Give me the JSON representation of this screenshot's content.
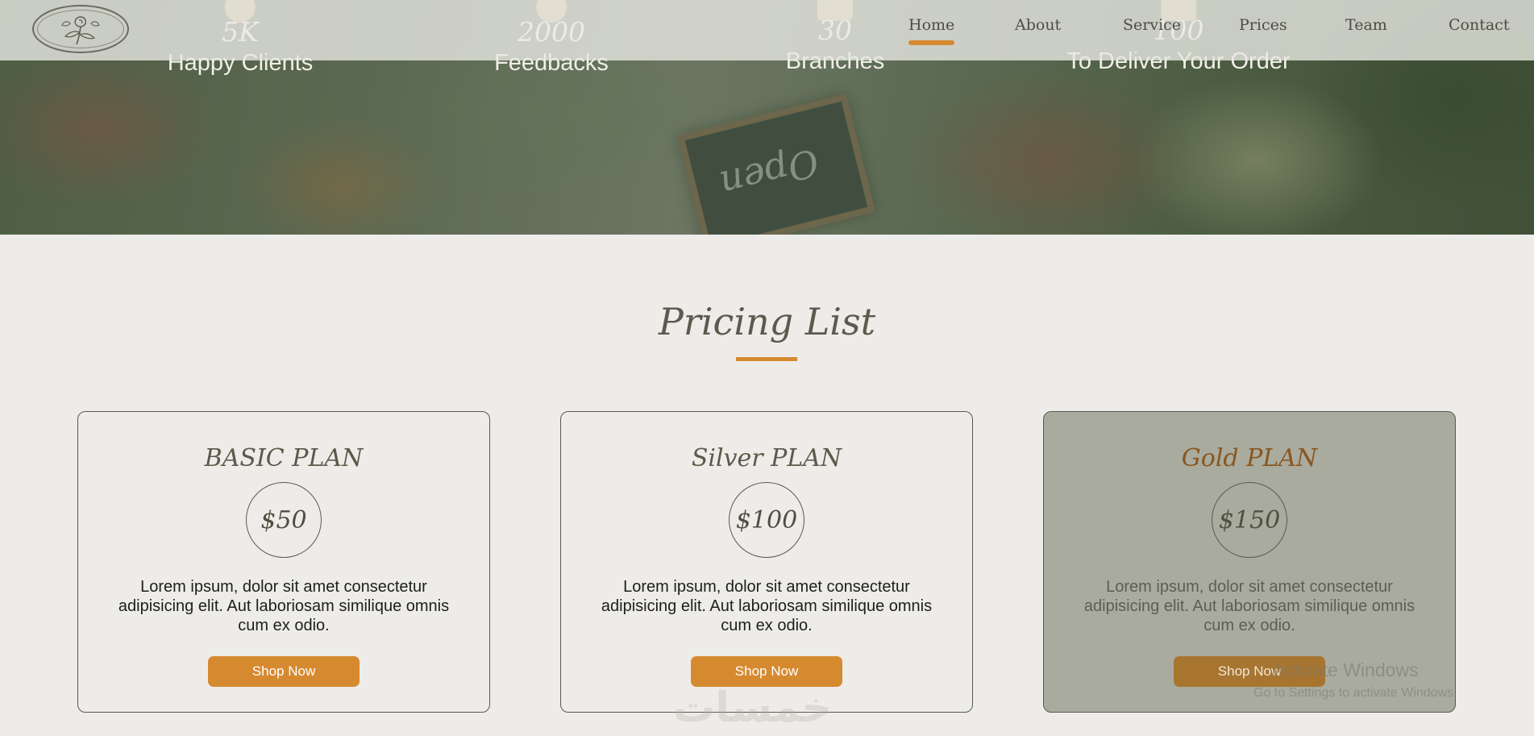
{
  "nav": {
    "links": [
      {
        "label": "Home",
        "active": true
      },
      {
        "label": "About",
        "active": false
      },
      {
        "label": "Service",
        "active": false
      },
      {
        "label": "Prices",
        "active": false
      },
      {
        "label": "Team",
        "active": false
      },
      {
        "label": "Contact",
        "active": false
      }
    ]
  },
  "hero": {
    "chalkboard_text": "Open",
    "stats": [
      {
        "number": "5K",
        "label": "Happy Clients",
        "icon": "smile-icon"
      },
      {
        "number": "2000",
        "label": "Feedbacks",
        "icon": "heart-icon"
      },
      {
        "number": "30",
        "label": "Branches",
        "icon": "store-icon"
      },
      {
        "number": "100",
        "label": "To Deliver Your Order",
        "icon": "truck-icon"
      }
    ]
  },
  "pricing": {
    "title": "Pricing List",
    "plans": [
      {
        "name": "BASIC PLAN",
        "price": "$50",
        "description": "Lorem ipsum, dolor sit amet consectetur adipisicing elit. Aut laboriosam similique omnis cum ex odio.",
        "button": "Shop Now"
      },
      {
        "name": "Silver PLAN",
        "price": "$100",
        "description": "Lorem ipsum, dolor sit amet consectetur adipisicing elit. Aut laboriosam similique omnis cum ex odio.",
        "button": "Shop Now"
      },
      {
        "name": "Gold PLAN",
        "price": "$150",
        "description": "Lorem ipsum, dolor sit amet consectetur adipisicing elit. Aut laboriosam similique omnis cum ex odio.",
        "button": "Shop Now"
      }
    ]
  },
  "watermarks": {
    "brand": "خمسات",
    "activate_title": "Activate Windows",
    "activate_sub": "Go to Settings to activate Windows."
  },
  "colors": {
    "accent": "#d68a30",
    "background": "#edece9",
    "text_dark": "#5c5a4e"
  }
}
